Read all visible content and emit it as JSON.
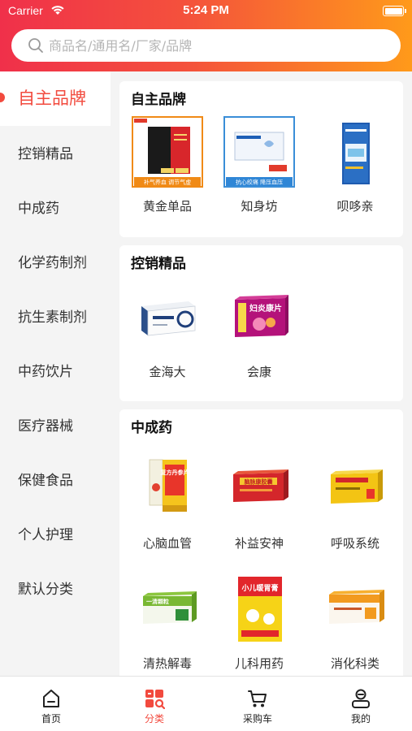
{
  "status_bar": {
    "carrier": "Carrier",
    "time": "5:24 PM"
  },
  "search": {
    "placeholder": "商品名/通用名/厂家/品牌"
  },
  "colors": {
    "accent": "#f24a3e",
    "header_start": "#f0304a",
    "header_end": "#ff9a1a"
  },
  "sidebar": {
    "items": [
      {
        "label": "自主品牌",
        "active": true
      },
      {
        "label": "控销精品"
      },
      {
        "label": "中成药"
      },
      {
        "label": "化学药制剂"
      },
      {
        "label": "抗生素制剂"
      },
      {
        "label": "中药饮片"
      },
      {
        "label": "医疗器械"
      },
      {
        "label": "保健食品"
      },
      {
        "label": "个人护理"
      },
      {
        "label": "默认分类"
      }
    ]
  },
  "sections": [
    {
      "title": "自主品牌",
      "products": [
        {
          "name": "黄金单品",
          "image": "red-box-product",
          "tag_line": "补气养血  调节气虚"
        },
        {
          "name": "知身坊",
          "image": "blue-box-product",
          "tag_line": "抗心绞痛  降压血压"
        },
        {
          "name": "呗哆亲",
          "image": "fever-patch-product"
        }
      ]
    },
    {
      "title": "控销精品",
      "products": [
        {
          "name": "金海大",
          "image": "white-blue-box-product"
        },
        {
          "name": "会康",
          "image": "purple-box-product",
          "box_text": "妇炎康片"
        }
      ]
    },
    {
      "title": "中成药",
      "products": [
        {
          "name": "心脑血管",
          "image": "yellow-box-product",
          "box_text": "复方丹参片"
        },
        {
          "name": "补益安神",
          "image": "red-orange-box-product",
          "box_text": "脑脉康胶囊"
        },
        {
          "name": "呼吸系统",
          "image": "yellow-red-box-product"
        },
        {
          "name": "清热解毒",
          "image": "green-box-product",
          "box_text": "一清颗粒"
        },
        {
          "name": "儿科用药",
          "image": "kids-box-product",
          "box_text": "小儿暖胃膏"
        },
        {
          "name": "消化科类",
          "image": "orange-white-box-product"
        }
      ]
    }
  ],
  "tabbar": {
    "items": [
      {
        "label": "首页",
        "icon": "home-icon"
      },
      {
        "label": "分类",
        "icon": "category-icon",
        "active": true
      },
      {
        "label": "采购车",
        "icon": "cart-icon"
      },
      {
        "label": "我的",
        "icon": "profile-icon"
      }
    ]
  }
}
